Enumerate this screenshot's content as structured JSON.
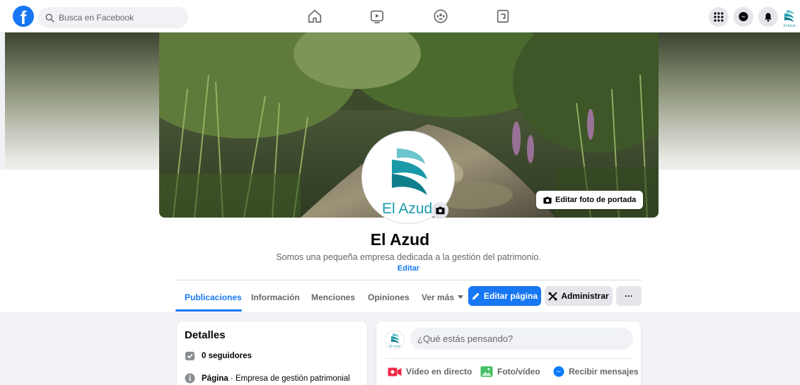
{
  "topbar": {
    "logo_letter": "f",
    "search_placeholder": "Busca en Facebook",
    "nav": [
      "home-icon",
      "watch-icon",
      "groups-icon",
      "gaming-icon"
    ],
    "right": [
      "menu-grid-icon",
      "messenger-icon",
      "notifications-icon"
    ]
  },
  "cover": {
    "edit_cover_label": "Editar foto de portada"
  },
  "profile": {
    "logo_text": "El Azud",
    "name": "El Azud",
    "description": "Somos una pequeña empresa dedicada a la gestión del patrimonio.",
    "edit_label": "Editar"
  },
  "tabs": [
    {
      "label": "Publicaciones",
      "active": true
    },
    {
      "label": "Información"
    },
    {
      "label": "Menciones"
    },
    {
      "label": "Opiniones"
    },
    {
      "label": "Ver más"
    }
  ],
  "actions": {
    "edit_page": "Editar página",
    "manage": "Administrar",
    "more": "···"
  },
  "details": {
    "title": "Detalles",
    "followers": "0 seguidores",
    "page_label": "Página",
    "page_category": " · Empresa de gestión patrimonial"
  },
  "composer": {
    "logo_text": "El Azud",
    "placeholder": "¿Qué estás pensando?",
    "live": "Vídeo en directo",
    "photo": "Foto/vídeo",
    "messages": "Recibir mensajes"
  },
  "colors": {
    "brand": "#1877f2",
    "teal": "#1a9aa8",
    "background": "#f0f2f5"
  }
}
